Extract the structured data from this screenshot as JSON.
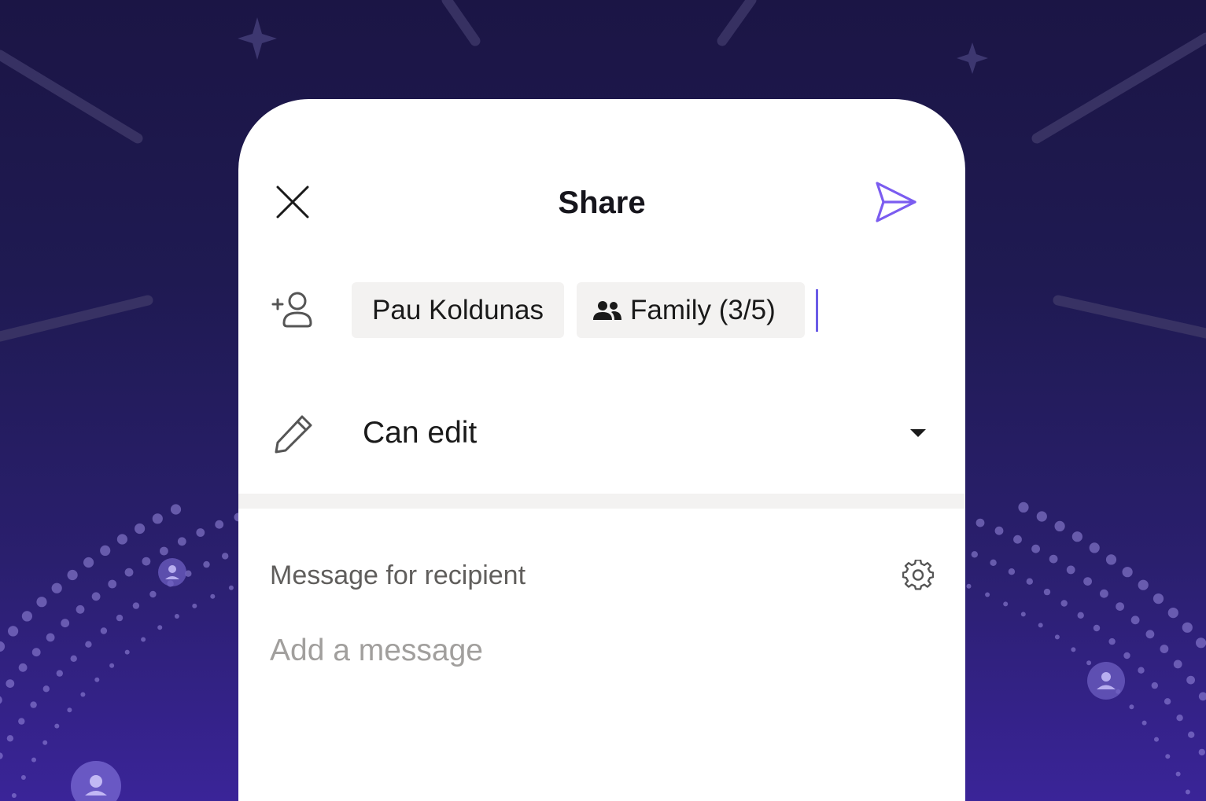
{
  "dialog": {
    "title": "Share"
  },
  "recipients": {
    "chips": [
      {
        "label": "Pau Koldunas"
      },
      {
        "label": "Family (3/5)"
      }
    ]
  },
  "permission": {
    "selected": "Can edit"
  },
  "message": {
    "label": "Message for recipient",
    "placeholder": "Add a message"
  },
  "icons": {
    "close": "close-icon",
    "send": "send-icon",
    "add_person": "add-person-icon",
    "group": "people-group-icon",
    "edit": "pencil-icon",
    "dropdown": "caret-down-icon",
    "settings": "gear-icon",
    "avatar": "person-avatar-icon"
  },
  "colors": {
    "accent": "#7b5cf0",
    "background_dark": "#1b1545",
    "background_purple": "#3a2498",
    "chip_background": "#f3f2f1"
  }
}
